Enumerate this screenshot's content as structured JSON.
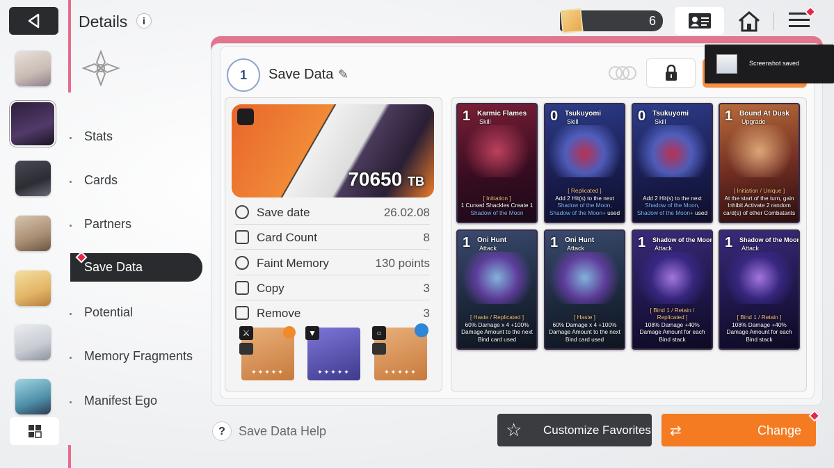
{
  "header": {
    "title": "Details",
    "info_icon": "info-icon",
    "currency_value": "6"
  },
  "menu": {
    "items": [
      "Stats",
      "Cards",
      "Partners",
      "Save Data",
      "Potential",
      "Memory Fragments",
      "Manifest Ego"
    ],
    "selected": "Save Data"
  },
  "save": {
    "badge_number": "1",
    "title": "Save Data",
    "score": "70650",
    "score_unit": "TB",
    "rows": [
      {
        "label": "Save date",
        "value": "26.02.08",
        "icon": "clock-icon"
      },
      {
        "label": "Card Count",
        "value": "8",
        "icon": "card-count-icon"
      },
      {
        "label": "Faint Memory",
        "value": "130 points",
        "icon": "brain-icon"
      },
      {
        "label": "Copy",
        "value": "3",
        "icon": "copy-icon"
      },
      {
        "label": "Remove",
        "value": "3",
        "icon": "remove-icon"
      }
    ],
    "equip_stars": "✦✦✦✦✦"
  },
  "toast": {
    "text": "Screenshot saved"
  },
  "cards": [
    {
      "cost": "1",
      "name": "Karmic Flames",
      "type": "Skill",
      "desc_pre": "[ Initiation ]",
      "desc": "1 Cursed Shackles Create 1 ",
      "desc_hl": "Shadow of the Moon",
      "desc_post": ""
    },
    {
      "cost": "0",
      "name": "Tsukuyomi",
      "type": "Skill",
      "desc_pre": "[ Replicated ]",
      "desc": "Add 2 Hit(s) to the next ",
      "desc_hl": "Shadow of the Moon, Shadow of the Moon+",
      "desc_post": " used"
    },
    {
      "cost": "0",
      "name": "Tsukuyomi",
      "type": "Skill",
      "desc_pre": "",
      "desc": "Add 2 Hit(s) to the next ",
      "desc_hl": "Shadow of the Moon, Shadow of the Moon+",
      "desc_post": " used"
    },
    {
      "cost": "1",
      "name": "Bound At Dusk",
      "type": "Upgrade",
      "desc_pre": "[ Initiation / Unique ]",
      "desc": "At the start of the turn, gain Inhibit Activate 2 random card(s) of other Combatants",
      "desc_hl": "",
      "desc_post": ""
    },
    {
      "cost": "1",
      "name": "Oni Hunt",
      "type": "Attack",
      "desc_pre": "[ Haste / Replicated ]",
      "desc": "60% Damage x 4 +100% Damage Amount to the next Bind card used",
      "desc_hl": "",
      "desc_post": ""
    },
    {
      "cost": "1",
      "name": "Oni Hunt",
      "type": "Attack",
      "desc_pre": "[ Haste ]",
      "desc": "60% Damage x 4 +100% Damage Amount to the next Bind card used",
      "desc_hl": "",
      "desc_post": ""
    },
    {
      "cost": "1",
      "name": "Shadow of the Moon",
      "type": "Attack",
      "desc_pre": "[ Bind 1 / Retain / Replicated ]",
      "desc": "108% Damage +40% Damage Amount for each Bind stack",
      "desc_hl": "",
      "desc_post": ""
    },
    {
      "cost": "1",
      "name": "Shadow of the Moon",
      "type": "Attack",
      "desc_pre": "[ Bind 1 / Retain ]",
      "desc": "108% Damage +40% Damage Amount for each Bind stack",
      "desc_hl": "",
      "desc_post": ""
    }
  ],
  "footer": {
    "help": "Save Data Help",
    "favorites": "Customize Favorites",
    "change": "Change"
  },
  "colors": {
    "accent": "#f47b21",
    "pink": "#e4758f",
    "dark": "#2a2b2e"
  }
}
